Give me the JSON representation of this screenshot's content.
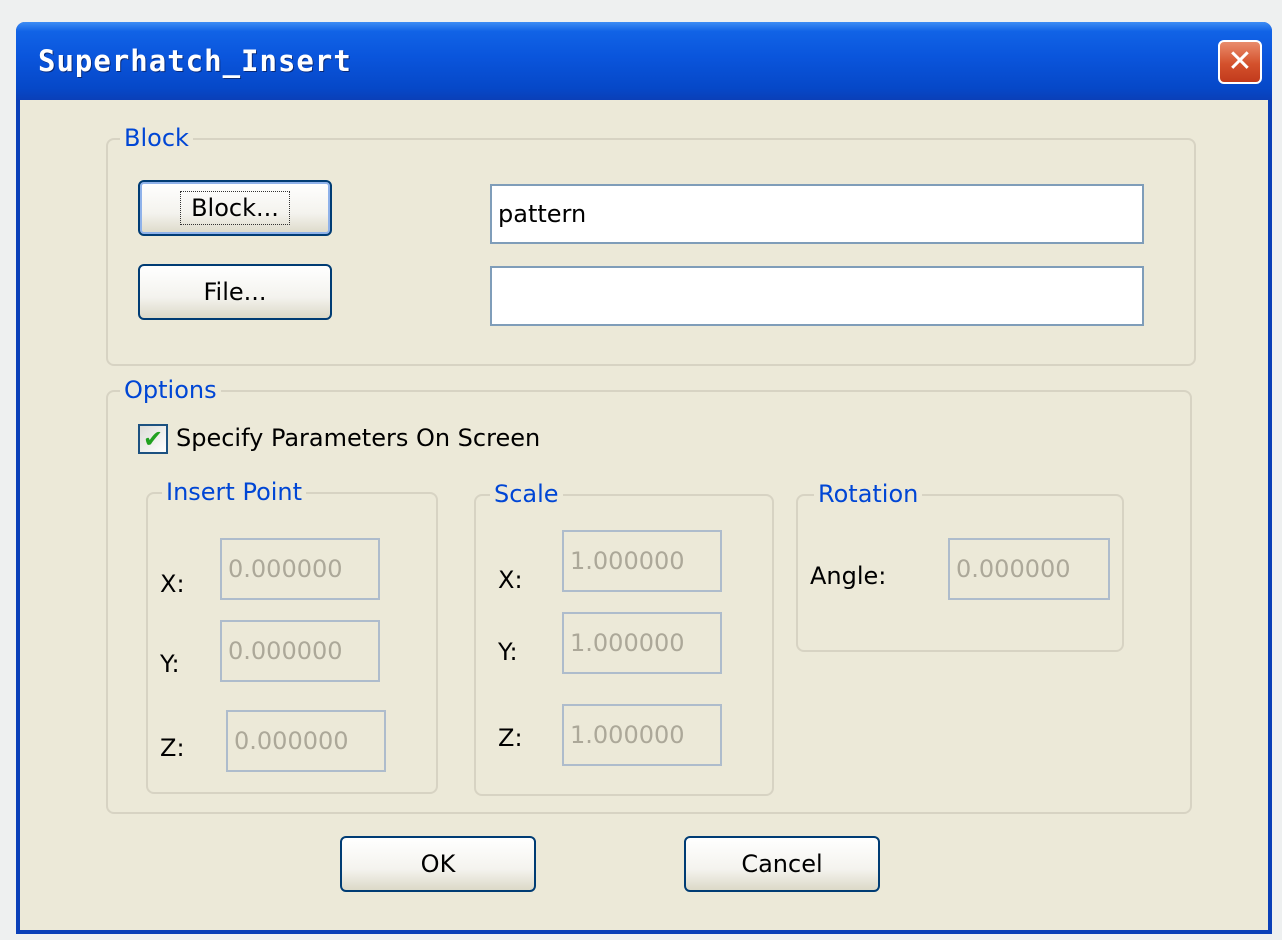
{
  "window": {
    "title": "Superhatch_Insert",
    "close_symbol": "✕"
  },
  "block_group": {
    "legend": "Block",
    "block_button": "Block...",
    "block_value": "pattern",
    "file_button": "File...",
    "file_value": ""
  },
  "options_group": {
    "legend": "Options",
    "specify_on_screen": {
      "label": "Specify Parameters On Screen",
      "checked": true,
      "check_mark": "✔"
    },
    "insert_point": {
      "legend": "Insert Point",
      "x_label": "X:",
      "x_value": "0.000000",
      "y_label": "Y:",
      "y_value": "0.000000",
      "z_label": "Z:",
      "z_value": "0.000000"
    },
    "scale": {
      "legend": "Scale",
      "x_label": "X:",
      "x_value": "1.000000",
      "y_label": "Y:",
      "y_value": "1.000000",
      "z_label": "Z:",
      "z_value": "1.000000"
    },
    "rotation": {
      "legend": "Rotation",
      "angle_label": "Angle:",
      "angle_value": "0.000000"
    }
  },
  "footer": {
    "ok_label": "OK",
    "cancel_label": "Cancel"
  },
  "colors": {
    "title_bar": "#0a55dc",
    "dialog_face": "#ece9d8",
    "group_legend": "#0046d5",
    "close_button": "#d4512c",
    "check_mark": "#21a121"
  },
  "icons": {
    "close": "close-icon",
    "check": "check-icon"
  }
}
